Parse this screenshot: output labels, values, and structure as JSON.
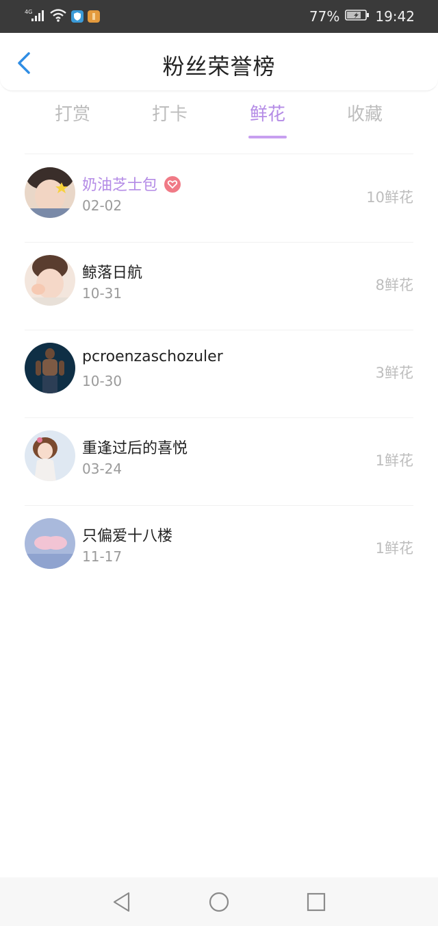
{
  "status_bar": {
    "network": "4G",
    "battery": "77%",
    "time": "19:42"
  },
  "header": {
    "title": "粉丝荣誉榜",
    "back_icon": "chevron-left-icon"
  },
  "tabs": [
    {
      "label": "打赏",
      "active": false
    },
    {
      "label": "打卡",
      "active": false
    },
    {
      "label": "鲜花",
      "active": true
    },
    {
      "label": "收藏",
      "active": false
    }
  ],
  "ranking": [
    {
      "name": "奶油芝士包",
      "date": "02-02",
      "amount": "10鲜花",
      "highlight": true
    },
    {
      "name": "鲸落日航",
      "date": "10-31",
      "amount": "8鲜花",
      "highlight": false
    },
    {
      "name": "pcroenzaschozuler",
      "date": "10-30",
      "amount": "3鲜花",
      "highlight": false
    },
    {
      "name": "重逢过后的喜悦",
      "date": "03-24",
      "amount": "1鲜花",
      "highlight": false
    },
    {
      "name": "只偏爱十八楼",
      "date": "11-17",
      "amount": "1鲜花",
      "highlight": false
    }
  ],
  "colors": {
    "accent": "#b48be6",
    "status_bar": "#3a3a3a",
    "back_icon": "#2f8de4",
    "badge": "#f07a86"
  }
}
